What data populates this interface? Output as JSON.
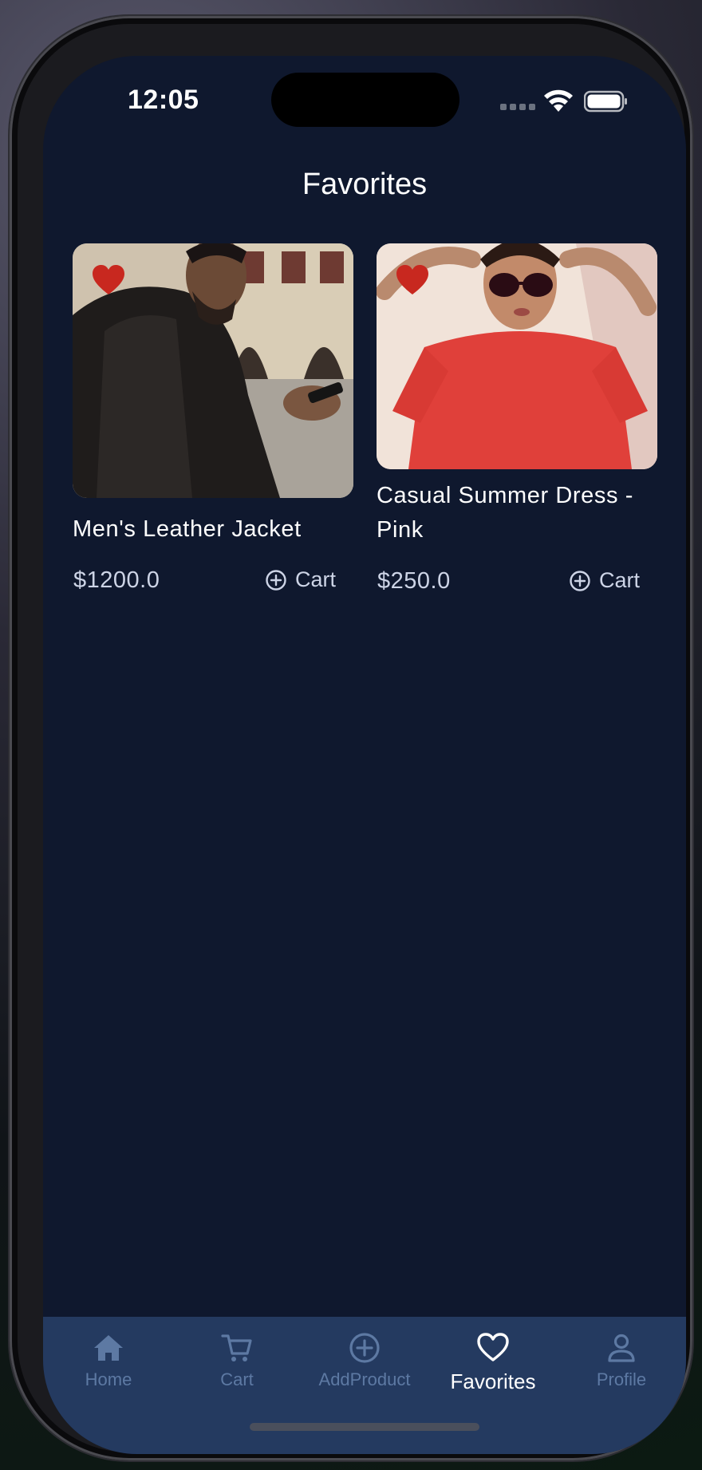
{
  "status_bar": {
    "time": "12:05"
  },
  "page": {
    "title": "Favorites"
  },
  "products": [
    {
      "name": "Men's Leather Jacket",
      "price": "$1200.0",
      "cart_label": "Cart",
      "favorited": true
    },
    {
      "name": "Casual Summer Dress - Pink",
      "price": "$250.0",
      "cart_label": "Cart",
      "favorited": true
    }
  ],
  "tabs": [
    {
      "label": "Home",
      "icon": "home-icon"
    },
    {
      "label": "Cart",
      "icon": "cart-icon"
    },
    {
      "label": "AddProduct",
      "icon": "plus-circle-icon"
    },
    {
      "label": "Favorites",
      "icon": "heart-outline-icon",
      "active": true
    },
    {
      "label": "Profile",
      "icon": "person-icon"
    }
  ],
  "colors": {
    "background": "#0f182e",
    "tabbar": "#243a60",
    "heart": "#c8281f",
    "inactive_tab": "#5d79a3",
    "active_tab": "#ffffff"
  }
}
